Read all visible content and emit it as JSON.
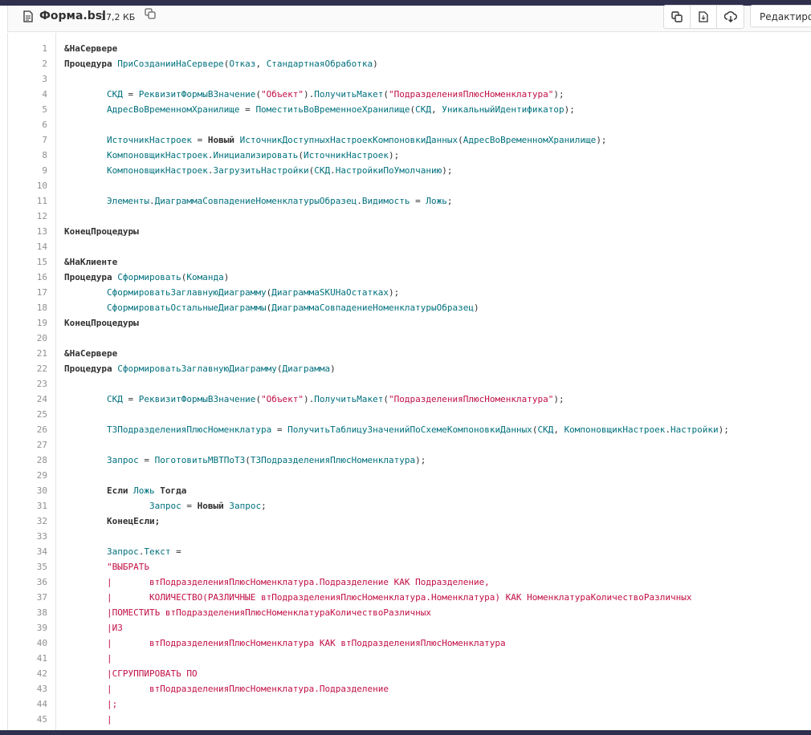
{
  "file": {
    "name": "Форма.bsl",
    "size": "17,2 КБ",
    "icons": [
      "file-icon",
      "copy-path-icon"
    ]
  },
  "toolbar": {
    "buttons": [
      "copy-source-icon",
      "open-raw-icon",
      "download-icon"
    ],
    "edit_label": "Редактировать"
  },
  "code": {
    "lines": [
      {
        "n": "1",
        "t": [
          [
            "kw",
            "&НаСервере"
          ]
        ]
      },
      {
        "n": "2",
        "t": [
          [
            "kw",
            "Процедура"
          ],
          [
            "",
            ""
          ],
          [
            "id",
            " ПриСозданииНаСервере"
          ],
          [
            "",
            "("
          ],
          [
            "id",
            "Отказ"
          ],
          [
            "",
            ", "
          ],
          [
            "id",
            "СтандартнаяОбработка"
          ],
          [
            "",
            ")"
          ]
        ]
      },
      {
        "n": "3",
        "t": []
      },
      {
        "n": "4",
        "t": [
          [
            "",
            "        "
          ],
          [
            "id",
            "СКД"
          ],
          [
            "",
            " = "
          ],
          [
            "id",
            "РеквизитФормыВЗначение"
          ],
          [
            "",
            "("
          ],
          [
            "str",
            "\"Объект\""
          ],
          [
            "",
            ")."
          ],
          [
            "id",
            "ПолучитьМакет"
          ],
          [
            "",
            "("
          ],
          [
            "str",
            "\"ПодразделенияПлюсНоменклатура\""
          ],
          [
            "",
            ");"
          ]
        ]
      },
      {
        "n": "5",
        "t": [
          [
            "",
            "        "
          ],
          [
            "id",
            "АдресВоВременномХранилище"
          ],
          [
            "",
            " = "
          ],
          [
            "id",
            "ПоместитьВоВременноеХранилище"
          ],
          [
            "",
            "("
          ],
          [
            "id",
            "СКД"
          ],
          [
            "",
            ", "
          ],
          [
            "id",
            "УникальныйИдентификатор"
          ],
          [
            "",
            ");"
          ]
        ]
      },
      {
        "n": "6",
        "t": []
      },
      {
        "n": "7",
        "t": [
          [
            "",
            "        "
          ],
          [
            "id",
            "ИсточникНастроек"
          ],
          [
            "",
            " = "
          ],
          [
            "kw",
            "Новый"
          ],
          [
            "id",
            " ИсточникДоступныхНастроекКомпоновкиДанных"
          ],
          [
            "",
            "("
          ],
          [
            "id",
            "АдресВоВременномХранилище"
          ],
          [
            "",
            ");"
          ]
        ]
      },
      {
        "n": "8",
        "t": [
          [
            "",
            "        "
          ],
          [
            "id",
            "КомпоновщикНастроек"
          ],
          [
            "",
            "."
          ],
          [
            "id",
            "Инициализировать"
          ],
          [
            "",
            "("
          ],
          [
            "id",
            "ИсточникНастроек"
          ],
          [
            "",
            ");"
          ]
        ]
      },
      {
        "n": "9",
        "t": [
          [
            "",
            "        "
          ],
          [
            "id",
            "КомпоновщикНастроек"
          ],
          [
            "",
            "."
          ],
          [
            "id",
            "ЗагрузитьНастройки"
          ],
          [
            "",
            "("
          ],
          [
            "id",
            "СКД"
          ],
          [
            "",
            "."
          ],
          [
            "id",
            "НастройкиПоУмолчанию"
          ],
          [
            "",
            ");"
          ]
        ]
      },
      {
        "n": "10",
        "t": []
      },
      {
        "n": "11",
        "t": [
          [
            "",
            "        "
          ],
          [
            "id",
            "Элементы"
          ],
          [
            "",
            "."
          ],
          [
            "id",
            "ДиаграммаСовпадениеНоменклатурыОбразец"
          ],
          [
            "",
            "."
          ],
          [
            "id",
            "Видимость"
          ],
          [
            "",
            " = "
          ],
          [
            "id",
            "Ложь"
          ],
          [
            "",
            ";"
          ]
        ]
      },
      {
        "n": "12",
        "t": []
      },
      {
        "n": "13",
        "t": [
          [
            "kw",
            "КонецПроцедуры"
          ]
        ]
      },
      {
        "n": "14",
        "t": []
      },
      {
        "n": "15",
        "t": [
          [
            "kw",
            "&НаКлиенте"
          ]
        ]
      },
      {
        "n": "16",
        "t": [
          [
            "kw",
            "Процедура"
          ],
          [
            "id",
            " Сформировать"
          ],
          [
            "",
            "("
          ],
          [
            "id",
            "Команда"
          ],
          [
            "",
            ")"
          ]
        ]
      },
      {
        "n": "17",
        "t": [
          [
            "",
            "        "
          ],
          [
            "id",
            "СформироватьЗаглавнуюДиаграмму"
          ],
          [
            "",
            "("
          ],
          [
            "id",
            "ДиаграммаSKUНаОстатках"
          ],
          [
            "",
            ");"
          ]
        ]
      },
      {
        "n": "18",
        "t": [
          [
            "",
            "        "
          ],
          [
            "id",
            "СформироватьОстальныеДиаграммы"
          ],
          [
            "",
            "("
          ],
          [
            "id",
            "ДиаграммаСовпадениеНоменклатурыОбразец"
          ],
          [
            "",
            ")"
          ]
        ]
      },
      {
        "n": "19",
        "t": [
          [
            "kw",
            "КонецПроцедуры"
          ]
        ]
      },
      {
        "n": "20",
        "t": []
      },
      {
        "n": "21",
        "t": [
          [
            "kw",
            "&НаСервере"
          ]
        ]
      },
      {
        "n": "22",
        "t": [
          [
            "kw",
            "Процедура"
          ],
          [
            "id",
            " СформироватьЗаглавнуюДиаграмму"
          ],
          [
            "",
            "("
          ],
          [
            "id",
            "Диаграмма"
          ],
          [
            "",
            ")"
          ]
        ]
      },
      {
        "n": "23",
        "t": []
      },
      {
        "n": "24",
        "t": [
          [
            "",
            "        "
          ],
          [
            "id",
            "СКД"
          ],
          [
            "",
            " = "
          ],
          [
            "id",
            "РеквизитФормыВЗначение"
          ],
          [
            "",
            "("
          ],
          [
            "str",
            "\"Объект\""
          ],
          [
            "",
            ")."
          ],
          [
            "id",
            "ПолучитьМакет"
          ],
          [
            "",
            "("
          ],
          [
            "str",
            "\"ПодразделенияПлюсНоменклатура\""
          ],
          [
            "",
            ");"
          ]
        ]
      },
      {
        "n": "25",
        "t": []
      },
      {
        "n": "26",
        "t": [
          [
            "",
            "        "
          ],
          [
            "id",
            "ТЗПодразделенияПлюсНоменклатура"
          ],
          [
            "",
            " = "
          ],
          [
            "id",
            "ПолучитьТаблицуЗначенийПоСхемеКомпоновкиДанных"
          ],
          [
            "",
            "("
          ],
          [
            "id",
            "СКД"
          ],
          [
            "",
            ", "
          ],
          [
            "id",
            "КомпоновщикНастроек"
          ],
          [
            "",
            "."
          ],
          [
            "id",
            "Настройки"
          ],
          [
            "",
            ");"
          ]
        ]
      },
      {
        "n": "27",
        "t": []
      },
      {
        "n": "28",
        "t": [
          [
            "",
            "        "
          ],
          [
            "id",
            "Запрос"
          ],
          [
            "",
            " = "
          ],
          [
            "id",
            "ПоготовитьМВТПоТЗ"
          ],
          [
            "",
            "("
          ],
          [
            "id",
            "ТЗПодразделенияПлюсНоменклатура"
          ],
          [
            "",
            ");"
          ]
        ]
      },
      {
        "n": "29",
        "t": []
      },
      {
        "n": "30",
        "t": [
          [
            "",
            "        "
          ],
          [
            "kw",
            "Если"
          ],
          [
            "id",
            " Ложь"
          ],
          [
            "kw",
            " Тогда"
          ]
        ]
      },
      {
        "n": "31",
        "t": [
          [
            "",
            "                "
          ],
          [
            "id",
            "Запрос"
          ],
          [
            "",
            " = "
          ],
          [
            "kw",
            "Новый"
          ],
          [
            "id",
            " Запрос"
          ],
          [
            "",
            ";"
          ]
        ]
      },
      {
        "n": "32",
        "t": [
          [
            "",
            "        "
          ],
          [
            "kw",
            "КонецЕсли;"
          ]
        ]
      },
      {
        "n": "33",
        "t": []
      },
      {
        "n": "34",
        "t": [
          [
            "",
            "        "
          ],
          [
            "id",
            "Запрос"
          ],
          [
            "",
            "."
          ],
          [
            "id",
            "Текст"
          ],
          [
            "",
            " ="
          ]
        ]
      },
      {
        "n": "35",
        "t": [
          [
            "",
            "        "
          ],
          [
            "str",
            "\"ВЫБРАТЬ"
          ]
        ]
      },
      {
        "n": "36",
        "t": [
          [
            "",
            "        "
          ],
          [
            "str",
            "|       втПодразделенияПлюсНоменклатура.Подразделение КАК Подразделение,"
          ]
        ]
      },
      {
        "n": "37",
        "t": [
          [
            "",
            "        "
          ],
          [
            "str",
            "|       КОЛИЧЕСТВО(РАЗЛИЧНЫЕ втПодразделенияПлюсНоменклатура.Номенклатура) КАК НоменклатураКоличествоРазличных"
          ]
        ]
      },
      {
        "n": "38",
        "t": [
          [
            "",
            "        "
          ],
          [
            "str",
            "|ПОМЕСТИТЬ втПодразделенияПлюсНоменклатураКоличествоРазличных"
          ]
        ]
      },
      {
        "n": "39",
        "t": [
          [
            "",
            "        "
          ],
          [
            "str",
            "|ИЗ"
          ]
        ]
      },
      {
        "n": "40",
        "t": [
          [
            "",
            "        "
          ],
          [
            "str",
            "|       втПодразделенияПлюсНоменклатура КАК втПодразделенияПлюсНоменклатура"
          ]
        ]
      },
      {
        "n": "41",
        "t": [
          [
            "",
            "        "
          ],
          [
            "str",
            "|"
          ]
        ]
      },
      {
        "n": "42",
        "t": [
          [
            "",
            "        "
          ],
          [
            "str",
            "|СГРУППИРОВАТЬ ПО"
          ]
        ]
      },
      {
        "n": "43",
        "t": [
          [
            "",
            "        "
          ],
          [
            "str",
            "|       втПодразделенияПлюсНоменклатура.Подразделение"
          ]
        ]
      },
      {
        "n": "44",
        "t": [
          [
            "",
            "        "
          ],
          [
            "str",
            "|;"
          ]
        ]
      },
      {
        "n": "45",
        "t": [
          [
            "",
            "        "
          ],
          [
            "str",
            "|"
          ]
        ]
      }
    ]
  }
}
